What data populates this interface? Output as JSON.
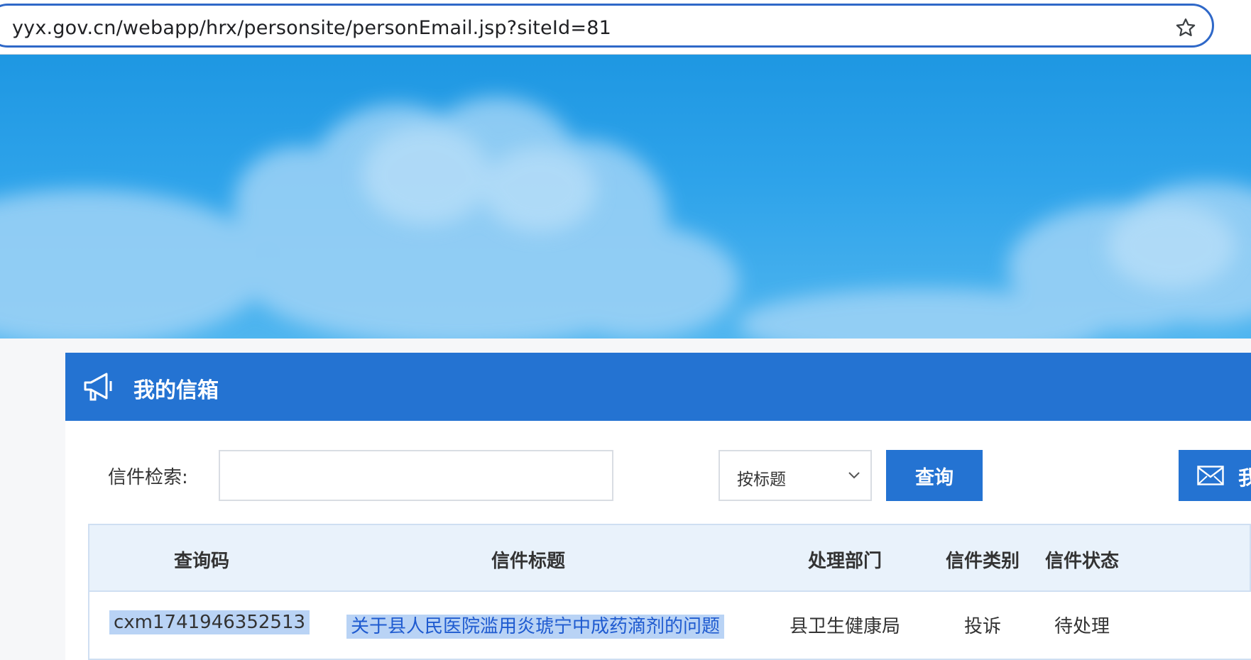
{
  "browser": {
    "edge_glyph": "s",
    "url": "yyx.gov.cn/webapp/hrx/personsite/personEmail.jsp?siteId=81",
    "bookmark_icon": "star-icon"
  },
  "colors": {
    "accent": "#2473d2",
    "banner_sky": "#2ea3ea",
    "table_header_bg": "#e9f2fb",
    "link": "#1f5bd0",
    "selection": "#b9d3f5"
  },
  "panel": {
    "icon": "megaphone-icon",
    "title": "我的信箱"
  },
  "search": {
    "label": "信件检索:",
    "input_value": "",
    "select_value": "按标题",
    "query_button": "查询",
    "write_button_icon": "envelope-icon",
    "write_button_label": "我"
  },
  "table": {
    "headers": [
      "查询码",
      "信件标题",
      "处理部门",
      "信件类别",
      "信件状态"
    ],
    "rows": [
      {
        "code": "cxm1741946352513",
        "title": "关于县人民医院滥用炎琥宁中成药滴剂的问题",
        "department": "县卫生健康局",
        "category": "投诉",
        "status": "待处理"
      }
    ]
  }
}
